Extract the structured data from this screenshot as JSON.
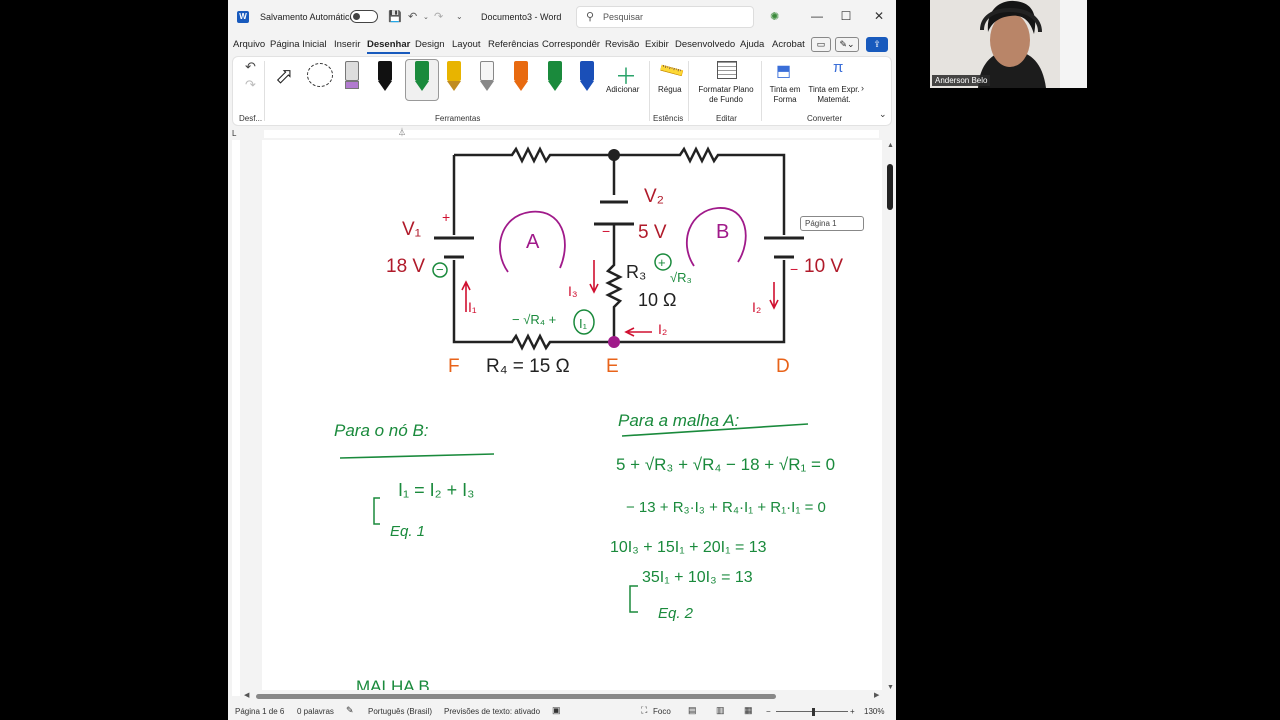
{
  "titlebar": {
    "autosave_label": "Salvamento Automático",
    "document_title": "Documento3 - Word",
    "search_placeholder": "Pesquisar",
    "minimize": "—",
    "maximize": "☐",
    "close": "✕"
  },
  "tabs": [
    "Arquivo",
    "Página Inicial",
    "Inserir",
    "Desenhar",
    "Design",
    "Layout",
    "Referências",
    "Correspondêr",
    "Revisão",
    "Exibir",
    "Desenvolvedo",
    "Ajuda",
    "Acrobat"
  ],
  "active_tab": "Desenhar",
  "ribbon": {
    "groups": [
      "Desf...",
      "Ferramentas",
      "Estêncis",
      "Editar",
      "Converter"
    ],
    "buttons": {
      "add": "Adicionar",
      "ruler": "Régua",
      "format_background": "Formatar Plano de Fundo",
      "ink_to_shape": "Tinta em Forma",
      "ink_to_math": "Tinta em Expr. Matemát."
    },
    "pen_colors": [
      "#111111",
      "#1a8a3c",
      "#e8b400",
      "#f0f0f0",
      "#e86a10",
      "#1a8a3c",
      "#1a4fb8"
    ]
  },
  "page_tooltip": "Página 1",
  "circuit": {
    "v1_name": "V₁",
    "v1_value": "18 V",
    "v2_name": "V₂",
    "v2_value": "5 V",
    "v3_value": "10 V",
    "r3_name": "R₃",
    "r3_value": "10 Ω",
    "r4_label": "R₄ = 15 Ω",
    "node_f": "F",
    "node_e": "E",
    "node_d": "D",
    "mesh_a": "A",
    "mesh_b": "B"
  },
  "notes": {
    "left_heading": "Para o nó B:",
    "left_eq": "I₁ = I₂ + I₃",
    "left_tag": "Eq. 1",
    "right_heading": "Para a malha A:",
    "right_eq1": "5 + √R₃ + √R₄ − 18 + √R₁ = 0",
    "right_eq2": "− 13 + R₃·I₃ + R₄·I₁ + R₁·I₁ = 0",
    "right_eq3": "10I₃ + 15I₁ + 20I₁ = 13",
    "right_eq4": "35I₁ + 10I₃ = 13",
    "right_tag": "Eq. 2",
    "bottom_heading": "MALHA B"
  },
  "statusbar": {
    "page": "Página 1 de 6",
    "words": "0 palavras",
    "language": "Português (Brasil)",
    "predictions": "Previsões de texto: ativado",
    "focus": "Foco",
    "zoom": "130%"
  },
  "webcam": {
    "name": "Anderson Belo"
  },
  "colors": {
    "accent": "#185abd",
    "ink_green": "#1a8a3c",
    "ink_magenta": "#c4168a",
    "ink_red": "#d01030",
    "label_red": "#b01a2a",
    "label_orange": "#e8631a"
  }
}
